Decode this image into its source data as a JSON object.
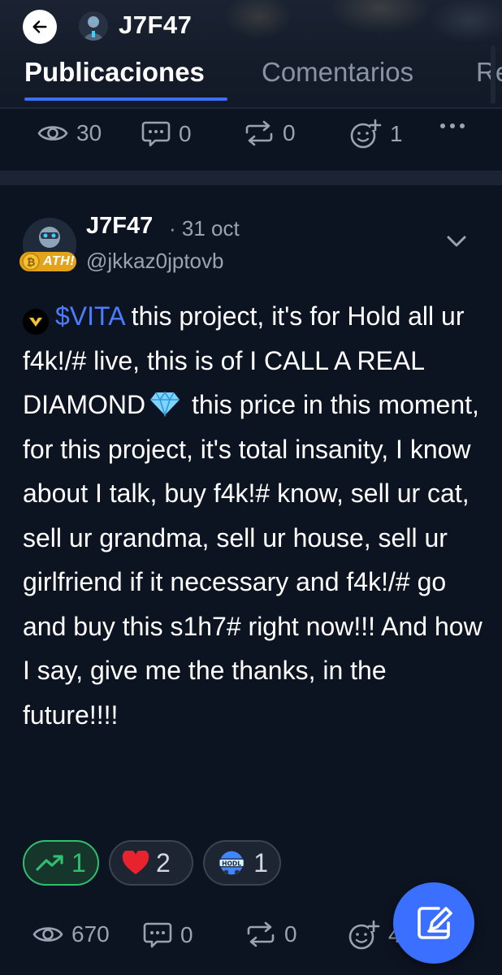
{
  "header": {
    "username": "J7F47"
  },
  "tabs": [
    {
      "label": "Publicaciones",
      "active": true
    },
    {
      "label": "Comentarios",
      "active": false
    },
    {
      "label": "Re",
      "active": false
    }
  ],
  "previous_post_stats": {
    "views": "30",
    "comments": "0",
    "reposts": "0",
    "reactions": "1"
  },
  "post": {
    "author": "J7F47",
    "date": "· 31 oct",
    "handle": "@jkkaz0jptovb",
    "badge_text": "ATH!",
    "cashtag": "$VITA",
    "text_before_diamond": " this project, it's for Hold all ur f4k!/# live, this is of I CALL A REAL DIAMOND",
    "text_after_diamond": " this price in this moment, for this project, it's total insanity, I know about I talk, buy f4k!# know, sell ur cat, sell ur grandma, sell ur house, sell ur girlfriend if it necessary and f4k!/# go and buy this s1h7# right now!!! And how I say, give me the thanks, in the future!!!!",
    "reactions": [
      {
        "icon": "trending-up-icon",
        "count": "1",
        "active": true
      },
      {
        "icon": "heart-icon",
        "count": "2",
        "active": false
      },
      {
        "icon": "hodl-icon",
        "count": "1",
        "active": false
      }
    ],
    "stats": {
      "views": "670",
      "comments": "0",
      "reposts": "0",
      "reactions": "4"
    }
  },
  "colors": {
    "background": "#0d1421",
    "accent": "#3a6fff",
    "cashtag": "#4a7dff",
    "muted": "#9aa3b2",
    "positive": "#2fbf71"
  }
}
